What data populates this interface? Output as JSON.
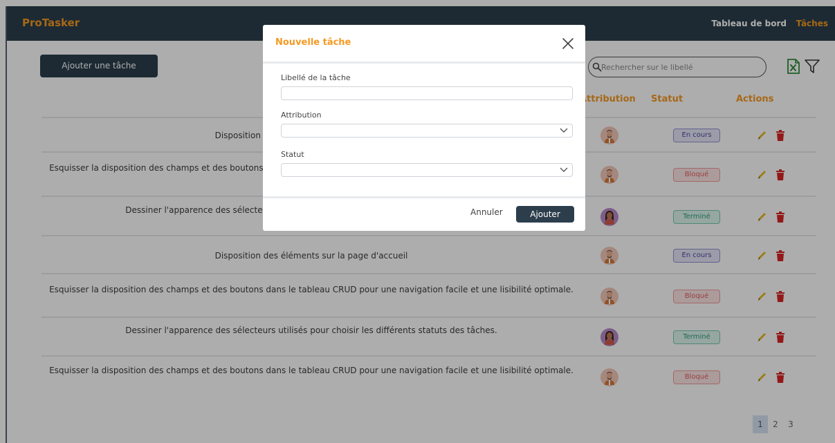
{
  "navbar": {
    "brand": "ProTasker",
    "links": [
      "Tableau de bord",
      "Tâches"
    ]
  },
  "toolbar": {
    "add_label": "Ajouter une tâche",
    "search_placeholder": "Rechercher sur le libellé"
  },
  "table": {
    "headers": {
      "attribution": "Attribution",
      "status": "Statut",
      "actions": "Actions"
    },
    "rows": [
      {
        "task": "Disposition des éléments sur la page d'accueil",
        "status": "En cours",
        "avatar": "man"
      },
      {
        "task": "Esquisser la disposition des champs et des boutons dans le tableau CRUD pour une navigation facile et une lisibilité optimale.",
        "status": "Bloqué",
        "avatar": "man"
      },
      {
        "task": "Dessiner l'apparence des sélecteurs utilisés pour choisir les différents statuts des tâches.",
        "status": "Terminé",
        "avatar": "woman"
      },
      {
        "task": "Disposition des éléments sur la page d'accueil",
        "status": "En cours",
        "avatar": "man"
      },
      {
        "task": "Esquisser la disposition des champs et des boutons dans le tableau CRUD pour une navigation facile et une lisibilité optimale.",
        "status": "Bloqué",
        "avatar": "man"
      },
      {
        "task": "Dessiner l'apparence des sélecteurs utilisés pour choisir les différents statuts des tâches.",
        "status": "Terminé",
        "avatar": "woman"
      },
      {
        "task": "Esquisser la disposition des champs et des boutons dans le tableau CRUD pour une navigation facile et une lisibilité optimale.",
        "status": "Bloqué",
        "avatar": "man"
      }
    ]
  },
  "pagination": {
    "pages": [
      "1",
      "2",
      "3"
    ],
    "current": "1"
  },
  "modal": {
    "title": "Nouvelle tâche",
    "fields": [
      {
        "label": "Libellé de la tâche",
        "value": ""
      },
      {
        "label": "Attribution",
        "value": ""
      },
      {
        "label": "Statut",
        "value": ""
      }
    ],
    "cancel_label": "Annuler",
    "submit_label": "Ajouter"
  },
  "colors": {
    "accent": "#f59a23",
    "navbar": "#2c3e4c",
    "edit_icon": "#e5b820",
    "delete_icon": "#d92626"
  },
  "icons": {
    "search": "search-icon",
    "export": "excel-icon",
    "filter": "filter-icon",
    "close": "close-icon",
    "edit": "pencil-icon",
    "delete": "trash-icon",
    "dropdown": "chevron-down-icon"
  }
}
